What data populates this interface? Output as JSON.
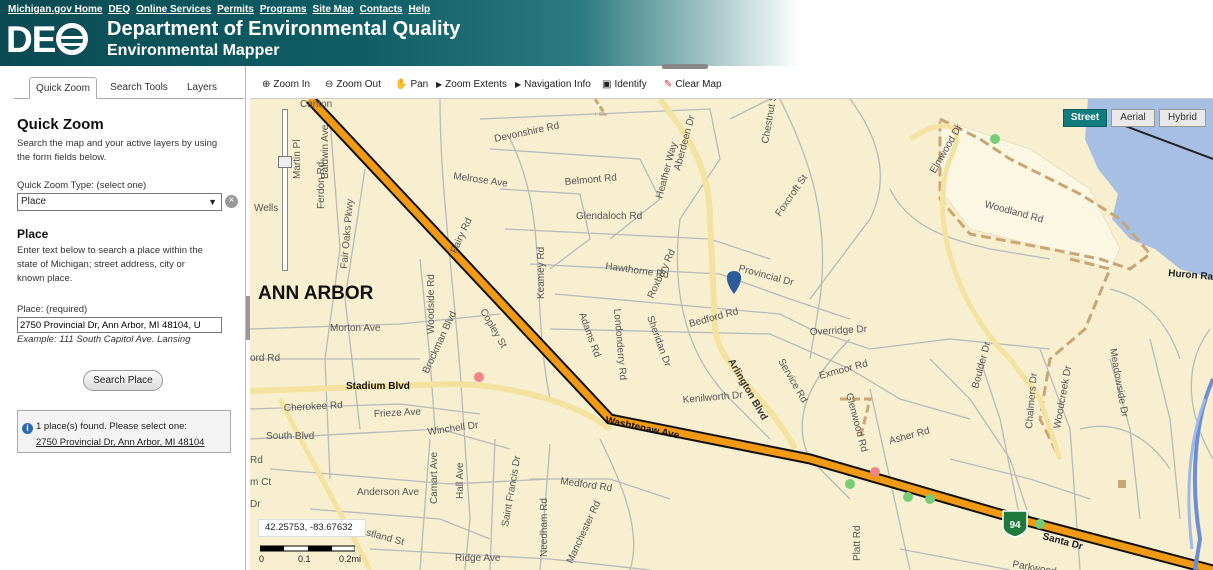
{
  "header": {
    "links": [
      "Michigan.gov Home",
      "DEQ",
      "Online Services",
      "Permits",
      "Programs",
      "Site Map",
      "Contacts",
      "Help"
    ],
    "logo": "DE",
    "title": "Department of Environmental Quality",
    "subtitle": "Environmental Mapper"
  },
  "sidebar": {
    "tabs": [
      "Quick Zoom",
      "Search Tools",
      "Layers"
    ],
    "title": "Quick Zoom",
    "intro": [
      "Search the map and your active layers by using",
      "the form fields below."
    ],
    "type_label": "Quick Zoom Type: (select one)",
    "type_value": "Place",
    "place_heading": "Place",
    "place_desc": [
      "Enter text below to search a place within the",
      "state of Michigan; street address, city or",
      "known place."
    ],
    "place_label": "Place: (required)",
    "place_value": "2750 Provincial Dr, Ann Arbor, MI 48104, U",
    "example": "Example: 111 South Capitol Ave. Lansing",
    "search_button": "Search Place",
    "result_text": "1 place(s) found. Please select one:",
    "result_link": "2750 Provincial Dr, Ann Arbor, MI 48104"
  },
  "toolbar": {
    "items": [
      "Zoom In",
      "Zoom Out",
      "Pan",
      "Zoom Extents",
      "Navigation Info",
      "Identify",
      "Clear Map"
    ]
  },
  "map": {
    "types": [
      "Street",
      "Aerial",
      "Hybrid"
    ],
    "city_label": "ANN ARBOR",
    "streets": [
      "Devonshire Rd",
      "Belmont Rd",
      "Melrose Ave",
      "Glendaloch Rd",
      "Fairy Rd",
      "Hawthorne Rd",
      "Provincial Dr",
      "Bedford Rd",
      "Arlington Blvd",
      "Kenilworth Dr",
      "Overridge Dr",
      "Exmoor Rd",
      "Service Rd",
      "Washtenaw Ave",
      "Stadium Blvd",
      "Morton Ave",
      "Cherokee Rd",
      "Frieze Ave",
      "Winchell Dr",
      "South Blvd",
      "Anderson Ave",
      "Medford Rd",
      "Crestland St",
      "Ridge Ave",
      "Aberdeen Dr",
      "Foxcroft St",
      "Heather Way",
      "Chestnut St",
      "Woodland Rd",
      "Elmwood Dr",
      "Huron Ra",
      "Asher Rd",
      "Glenwood Rd",
      "Boulder Dr",
      "Chalmers Dr",
      "Woodcreek Dr",
      "Meadowside Dr",
      "Adams Rd",
      "Londonderry Rd",
      "Sheridan Dr",
      "Roxbury Rd",
      "Keamey Rd",
      "Woodside Rd",
      "Brockman Blvd",
      "Copley St",
      "Fair Oaks Pkwy",
      "Baldwin Ave",
      "Ferdon Rd",
      "Martin Pl",
      "Wells",
      "Canton",
      "Camart Ave",
      "Hall Ave",
      "Saint Francis Dr",
      "Needham Rd",
      "Manchester Rd",
      "Platt Rd",
      "Parkwood",
      "Santa Dr",
      "ord Rd",
      "m Ct",
      "Dr",
      "Rd"
    ],
    "highway_shield": "94",
    "coordinates": "42.25753, -83.67632",
    "scale_labels": [
      "0",
      "0.1",
      "0.2mi"
    ]
  },
  "colors": {
    "header_dark": "#0b4a52",
    "map_background": "#f7efcf",
    "road_highlight": "#f29a14",
    "park_fill": "#fbf7e3",
    "water": "#a6bfe2",
    "map_type_active": "#127b7b"
  }
}
